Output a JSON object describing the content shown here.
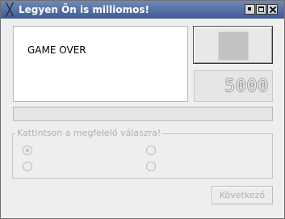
{
  "window": {
    "title": "Legyen Ön is milliomos!",
    "app_icon": "x-icon"
  },
  "question": {
    "text": "GAME OVER"
  },
  "prize": {
    "value": "5000"
  },
  "answers": {
    "group_label": "Kattintson a megfelelő válaszra!",
    "options": [
      {
        "label": "",
        "checked": true
      },
      {
        "label": "",
        "checked": false
      },
      {
        "label": "",
        "checked": false
      },
      {
        "label": "",
        "checked": false
      }
    ]
  },
  "buttons": {
    "next_label": "Következő"
  },
  "colors": {
    "titlebar": "#4a67a0",
    "window_bg": "#eeeeee",
    "disabled_text": "#b0b0b0"
  }
}
